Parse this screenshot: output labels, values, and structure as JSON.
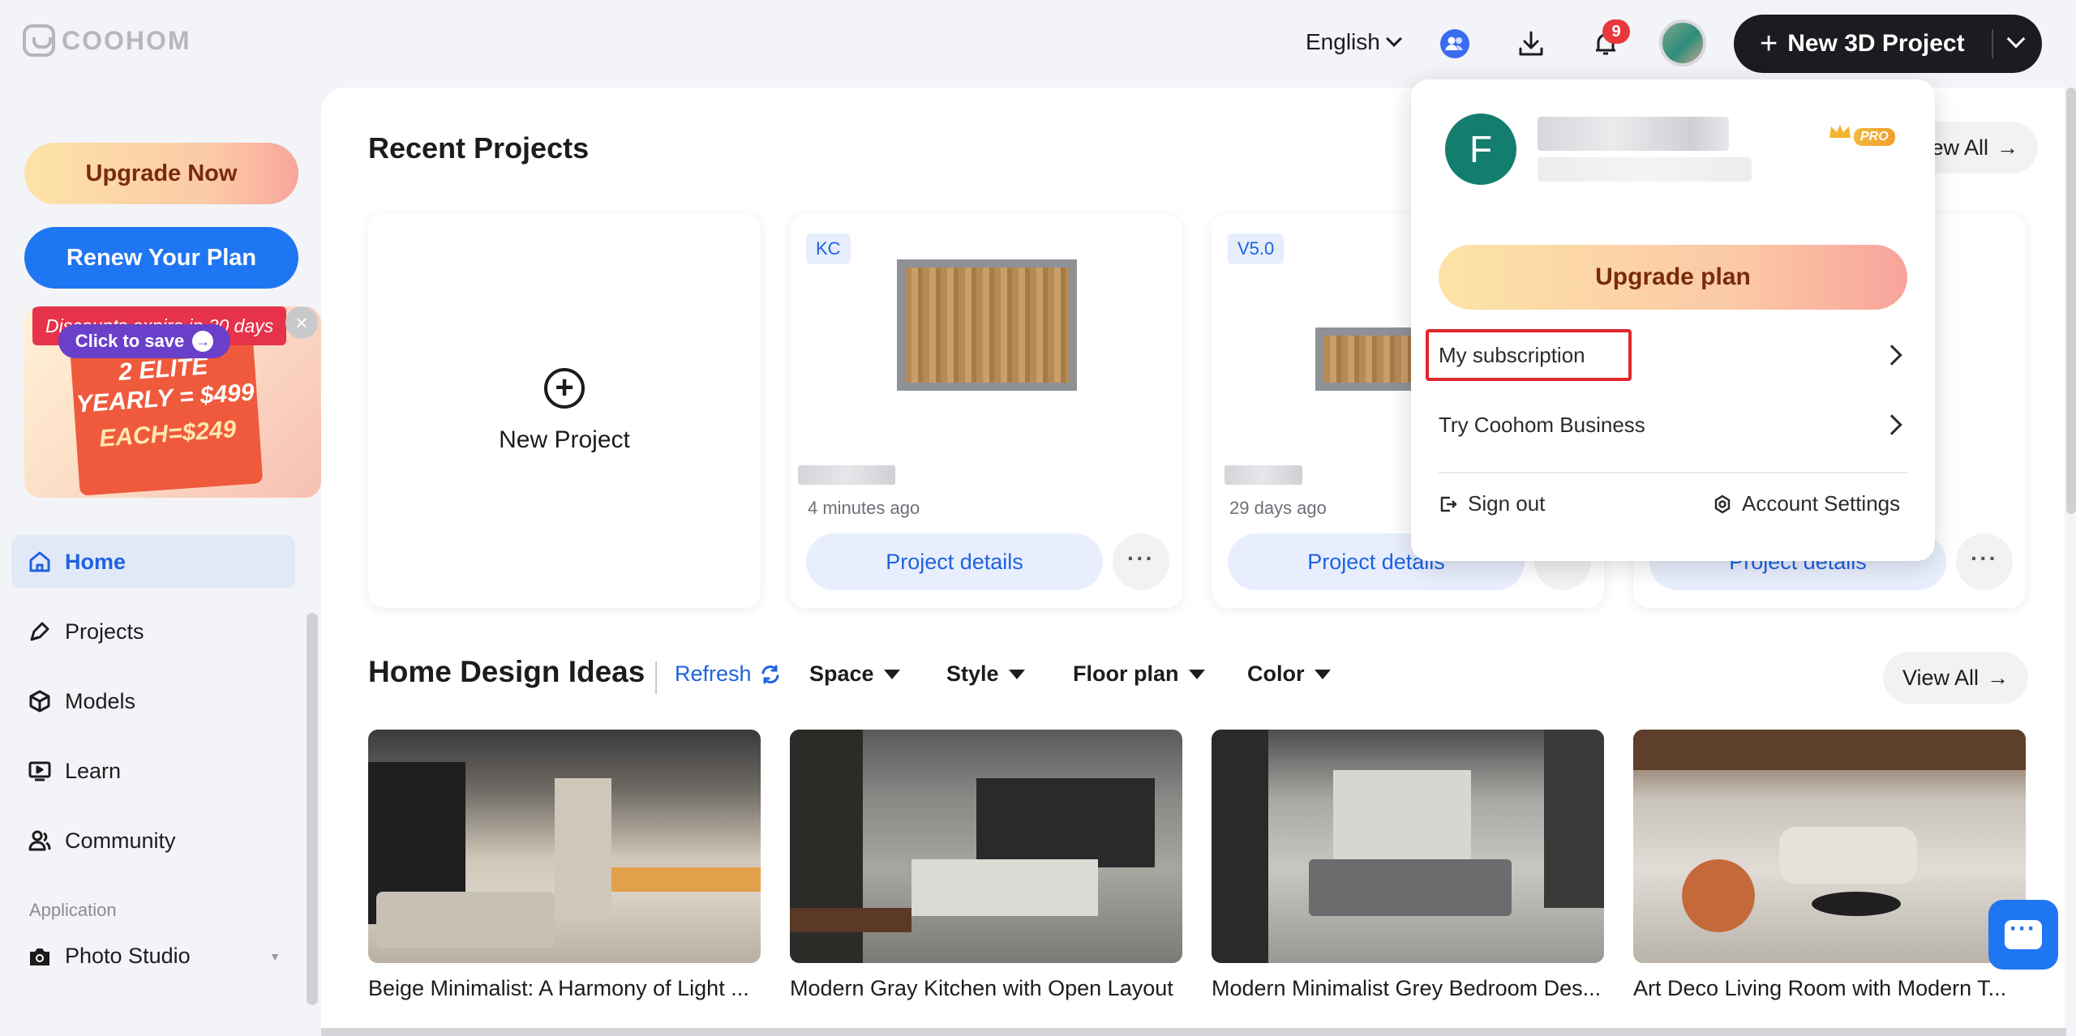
{
  "header": {
    "logo": "COOHOM",
    "language": "English",
    "notifications_count": "9",
    "new_project_label": "New 3D Project"
  },
  "sidebar": {
    "upgrade_now": "Upgrade Now",
    "renew_plan": "Renew Your Plan",
    "promo": {
      "tag": "Discounts expire in 30 days",
      "line1": "2 ELITE YEARLY = $499",
      "line2": "EACH=$249",
      "cta": "Click to save"
    },
    "items": [
      {
        "label": "Home",
        "icon": "home-icon",
        "active": true
      },
      {
        "label": "Projects",
        "icon": "projects-icon"
      },
      {
        "label": "Models",
        "icon": "cube-icon"
      },
      {
        "label": "Learn",
        "icon": "play-screen-icon"
      },
      {
        "label": "Community",
        "icon": "people-icon"
      }
    ],
    "section_label": "Application",
    "photo_studio": "Photo Studio"
  },
  "recent": {
    "title": "Recent Projects",
    "view_all": "View All",
    "new_project": "New Project",
    "projects": [
      {
        "tag": "KC",
        "time": "4 minutes ago",
        "details": "Project details"
      },
      {
        "tag": "V5.0",
        "time": "29 days ago",
        "details": "Project details"
      },
      {
        "tag": "",
        "time": "",
        "details": "Project details"
      }
    ]
  },
  "ideas": {
    "title": "Home Design Ideas",
    "refresh": "Refresh",
    "filters": [
      "Space",
      "Style",
      "Floor plan",
      "Color"
    ],
    "view_all": "View All",
    "items": [
      {
        "title": "Beige Minimalist: A Harmony of Light ..."
      },
      {
        "title": "Modern Gray Kitchen with Open Layout"
      },
      {
        "title": "Modern Minimalist Grey Bedroom Des..."
      },
      {
        "title": "Art Deco Living Room with Modern T..."
      }
    ]
  },
  "account_menu": {
    "avatar_letter": "F",
    "pro_badge": "PRO",
    "upgrade_plan": "Upgrade plan",
    "my_subscription": "My subscription",
    "try_business": "Try Coohom Business",
    "sign_out": "Sign out",
    "account_settings": "Account Settings"
  },
  "colors": {
    "accent": "#1f76f3",
    "highlight_box": "#e0262c",
    "brand_dark": "#1b1c20"
  }
}
